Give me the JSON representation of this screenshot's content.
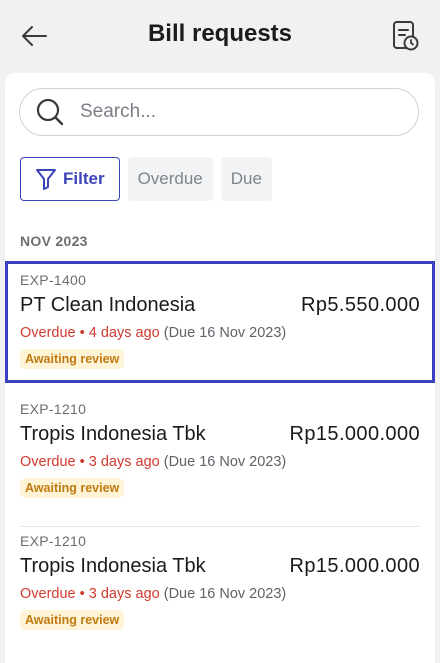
{
  "header": {
    "title": "Bill requests",
    "back_icon": "arrow-left-icon",
    "action_icon": "document-clock-icon"
  },
  "search": {
    "placeholder": "Search...",
    "value": ""
  },
  "filters": {
    "filter_label": "Filter",
    "chips": [
      "Overdue",
      "Due"
    ]
  },
  "section": {
    "label": "NOV 2023"
  },
  "bills": [
    {
      "code": "EXP-1400",
      "vendor": "PT Clean Indonesia",
      "amount": "Rp5.550.000",
      "status": "Overdue",
      "age": "4 days ago",
      "due": "(Due 16 Nov 2023)",
      "badge": "Awaiting review",
      "selected": true
    },
    {
      "code": "EXP-1210",
      "vendor": "Tropis Indonesia Tbk",
      "amount": "Rp15.000.000",
      "status": "Overdue",
      "age": "3 days ago",
      "due": "(Due 16 Nov 2023)",
      "badge": "Awaiting review",
      "selected": false
    },
    {
      "code": "EXP-1210",
      "vendor": "Tropis Indonesia Tbk",
      "amount": "Rp15.000.000",
      "status": "Overdue",
      "age": "3 days ago",
      "due": "(Due 16 Nov 2023)",
      "badge": "Awaiting review",
      "selected": false
    }
  ],
  "colors": {
    "accent": "#3b45b8",
    "overdue": "#d13a2f",
    "badge_bg": "#fff4d6",
    "badge_text": "#c07a10"
  }
}
